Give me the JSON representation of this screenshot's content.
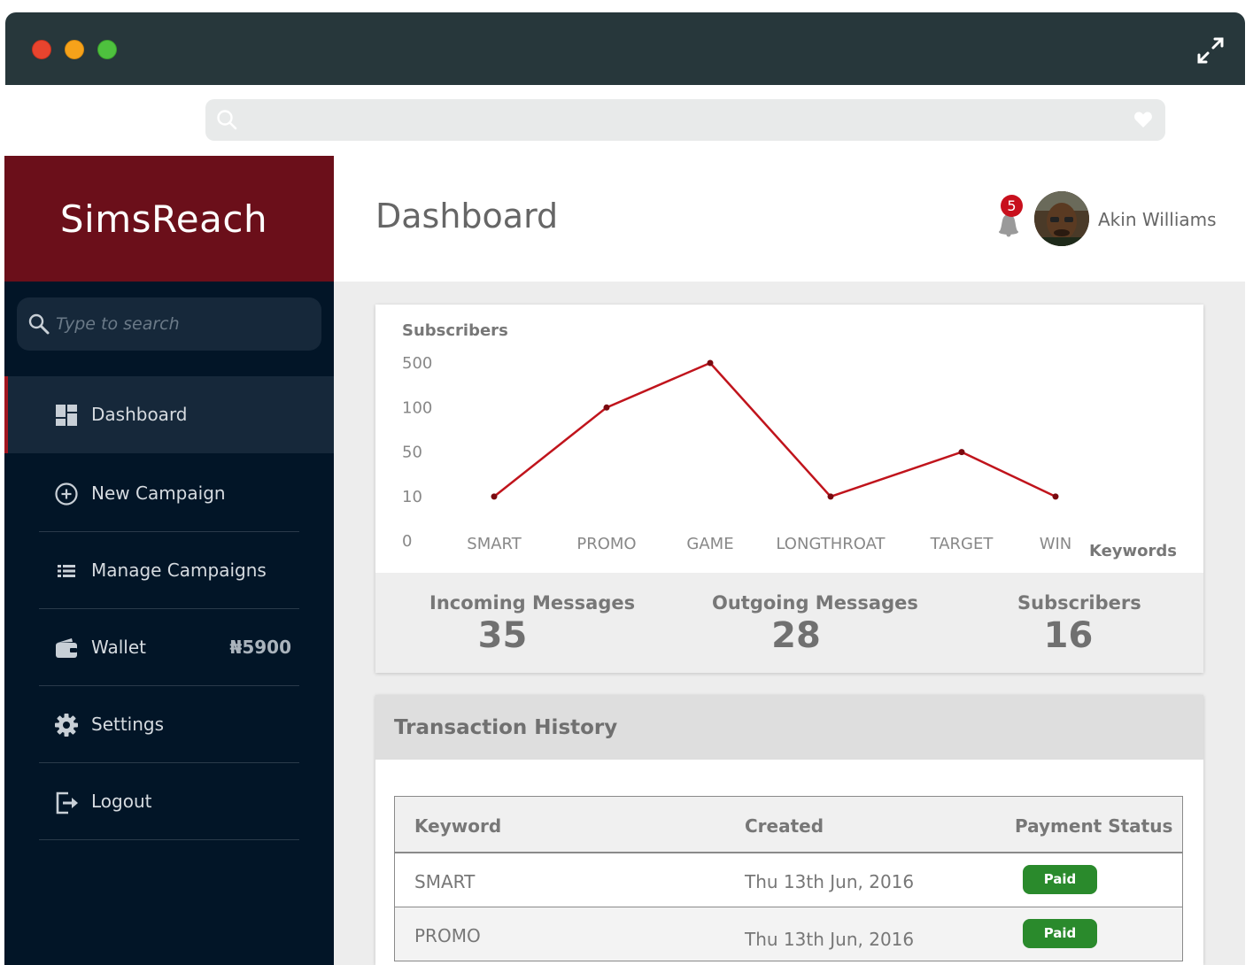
{
  "window": {
    "buttons": [
      "close",
      "minimize",
      "maximize"
    ],
    "expand_icon": "expand-arrows-icon"
  },
  "urlbar": {
    "search_icon": "search-icon",
    "favorite_icon": "heart-icon"
  },
  "sidebar": {
    "brand": "SimsReach",
    "search_placeholder": "Type to search",
    "items": [
      {
        "label": "Dashboard",
        "icon": "dashboard-icon",
        "active": true
      },
      {
        "label": "New Campaign",
        "icon": "plus-circle-icon"
      },
      {
        "label": "Manage Campaigns",
        "icon": "list-icon"
      },
      {
        "label": "Wallet",
        "icon": "wallet-icon",
        "amount": "₦5900"
      },
      {
        "label": "Settings",
        "icon": "gear-icon"
      },
      {
        "label": "Logout",
        "icon": "logout-icon"
      }
    ]
  },
  "header": {
    "title": "Dashboard",
    "notifications": "5",
    "user_name": "Akin Williams"
  },
  "chart_data": {
    "type": "line",
    "ylabel": "Subscribers",
    "xlabel": "Keywords",
    "y_ticks": [
      "500",
      "100",
      "50",
      "10",
      "0"
    ],
    "categories": [
      "SMART",
      "PROMO",
      "GAME",
      "LONGTHROAT",
      "TARGET",
      "WIN"
    ],
    "values": [
      10,
      100,
      500,
      10,
      50,
      10
    ],
    "color": "#c0141c",
    "grid": false
  },
  "stats": [
    {
      "label": "Incoming Messages",
      "value": "35"
    },
    {
      "label": "Outgoing Messages",
      "value": "28"
    },
    {
      "label": "Subscribers",
      "value": "16"
    }
  ],
  "transactions": {
    "title": "Transaction History",
    "columns": [
      "Keyword",
      "Created",
      "Payment Status"
    ],
    "rows": [
      {
        "keyword": "SMART",
        "created": "Thu 13th Jun, 2016",
        "status": "Paid"
      },
      {
        "keyword": "PROMO",
        "created": "Thu 13th Jun, 2016",
        "status": "Paid"
      }
    ],
    "status_color": "#2a8a2c"
  }
}
